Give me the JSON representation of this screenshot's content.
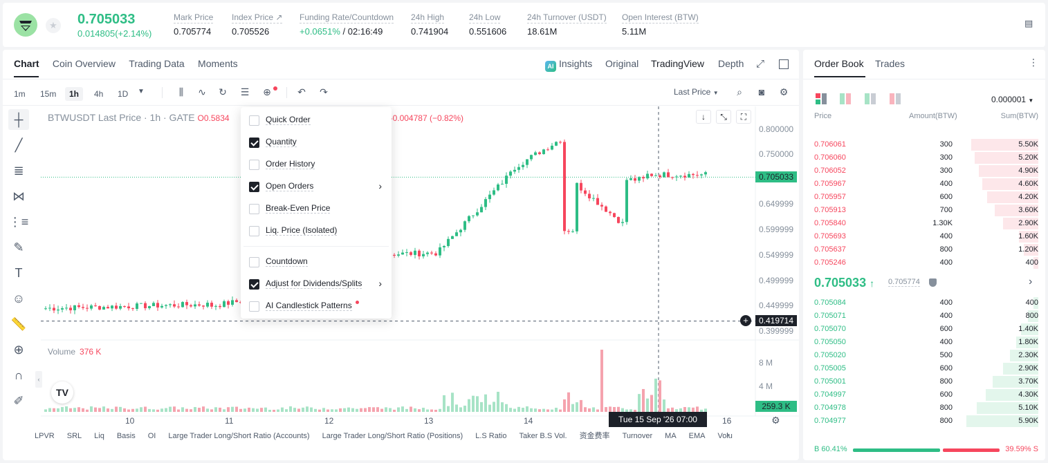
{
  "header": {
    "last_price": "0.705033",
    "change": "0.014805(+2.14%)",
    "stats": [
      {
        "label": "Mark Price",
        "value": "0.705774"
      },
      {
        "label": "Index Price ↗",
        "value": "0.705526"
      },
      {
        "label": "Funding Rate/Countdown",
        "value_green": "+0.0651%",
        "value": "/ 02:16:49"
      },
      {
        "label": "24h High",
        "value": "0.741904"
      },
      {
        "label": "24h Low",
        "value": "0.551606"
      },
      {
        "label": "24h Turnover (USDT)",
        "value": "18.61M"
      },
      {
        "label": "Open Interest (BTW)",
        "value": "5.11M"
      }
    ]
  },
  "chart_tabs": [
    "Chart",
    "Coin Overview",
    "Trading Data",
    "Moments"
  ],
  "view_tabs": {
    "insights": "Insights",
    "original": "Original",
    "tradingview": "TradingView",
    "depth": "Depth"
  },
  "timeframes": [
    "1m",
    "15m",
    "1h",
    "4h",
    "1D"
  ],
  "price_source": "Last Price",
  "legend": {
    "symbol": "BTWUSDT Last Price · 1h · GATE",
    "open": "O0.5834",
    "change": "-0.004787 (−0.82%)"
  },
  "price_axis": [
    "0.800000",
    "0.750000",
    "0.705033",
    "0.649999",
    "0.599999",
    "0.549999",
    "0.499999",
    "0.449999",
    "0.419714",
    "0.399999"
  ],
  "volume": {
    "label": "Volume",
    "value": "376 K",
    "axis": [
      "8 M",
      "4 M"
    ],
    "current": "259.3 K"
  },
  "date_axis": [
    "10",
    "11",
    "12",
    "13",
    "14",
    "16"
  ],
  "crosshair_date": "Tue 15 Sep '26   07:00",
  "indicators": [
    "LPVR",
    "SRL",
    "Liq",
    "Basis",
    "OI",
    "Large Trader Long/Short Ratio (Accounts)",
    "Large Trader Long/Short Ratio (Positions)",
    "L.S Ratio",
    "Taker B.S Vol.",
    "资金费率",
    "Turnover",
    "MA",
    "EMA",
    "Volu"
  ],
  "menu": [
    {
      "label": "Quick Order",
      "checked": false,
      "arrow": false
    },
    {
      "label": "Quantity",
      "checked": true,
      "arrow": false
    },
    {
      "label": "Order History",
      "checked": false,
      "arrow": false
    },
    {
      "label": "Open Orders",
      "checked": true,
      "arrow": true
    },
    {
      "label": "Break-Even Price",
      "checked": false,
      "arrow": false
    },
    {
      "label": "Liq. Price (Isolated)",
      "checked": false,
      "arrow": false
    },
    {
      "label": "Countdown",
      "checked": false,
      "arrow": false
    },
    {
      "label": "Adjust for Dividends/Splits",
      "checked": true,
      "arrow": true
    },
    {
      "label": "AI Candlestick Patterns",
      "checked": false,
      "arrow": false
    }
  ],
  "orderbook": {
    "tabs": [
      "Order Book",
      "Trades"
    ],
    "precision": "0.000001",
    "headers": [
      "Price",
      "Amount(BTW)",
      "Sum(BTW)"
    ],
    "asks": [
      {
        "price": "0.706061",
        "amount": "300",
        "sum": "5.50K",
        "depth": 0.93
      },
      {
        "price": "0.706060",
        "amount": "300",
        "sum": "5.20K",
        "depth": 0.88
      },
      {
        "price": "0.706052",
        "amount": "300",
        "sum": "4.90K",
        "depth": 0.83
      },
      {
        "price": "0.705967",
        "amount": "400",
        "sum": "4.60K",
        "depth": 0.78
      },
      {
        "price": "0.705957",
        "amount": "600",
        "sum": "4.20K",
        "depth": 0.71
      },
      {
        "price": "0.705913",
        "amount": "700",
        "sum": "3.60K",
        "depth": 0.61
      },
      {
        "price": "0.705840",
        "amount": "1.30K",
        "sum": "2.90K",
        "depth": 0.49
      },
      {
        "price": "0.705693",
        "amount": "400",
        "sum": "1.60K",
        "depth": 0.27
      },
      {
        "price": "0.705637",
        "amount": "800",
        "sum": "1.20K",
        "depth": 0.2
      },
      {
        "price": "0.705246",
        "amount": "400",
        "sum": "400",
        "depth": 0.07
      }
    ],
    "mid_price": "0.705033",
    "mark_price": "0.705774",
    "bids": [
      {
        "price": "0.705084",
        "amount": "400",
        "sum": "400",
        "depth": 0.07
      },
      {
        "price": "0.705071",
        "amount": "400",
        "sum": "800",
        "depth": 0.14
      },
      {
        "price": "0.705070",
        "amount": "600",
        "sum": "1.40K",
        "depth": 0.24
      },
      {
        "price": "0.705050",
        "amount": "400",
        "sum": "1.80K",
        "depth": 0.31
      },
      {
        "price": "0.705020",
        "amount": "500",
        "sum": "2.30K",
        "depth": 0.39
      },
      {
        "price": "0.705005",
        "amount": "600",
        "sum": "2.90K",
        "depth": 0.49
      },
      {
        "price": "0.705001",
        "amount": "800",
        "sum": "3.70K",
        "depth": 0.63
      },
      {
        "price": "0.704997",
        "amount": "600",
        "sum": "4.30K",
        "depth": 0.73
      },
      {
        "price": "0.704978",
        "amount": "800",
        "sum": "5.10K",
        "depth": 0.86
      },
      {
        "price": "0.704977",
        "amount": "800",
        "sum": "5.90K",
        "depth": 1.0
      }
    ],
    "buy_ratio": "B 60.41%",
    "sell_ratio": "39.59% S",
    "buy_fraction": 0.6041
  },
  "colors": {
    "up": "#2ebd85",
    "down": "#f6465d",
    "text": "#1d2129",
    "muted": "#86909c"
  }
}
